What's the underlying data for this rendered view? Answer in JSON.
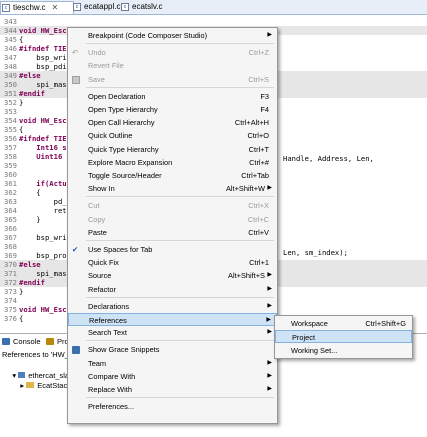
{
  "tabs": [
    {
      "label": "tieschw.c",
      "active": true,
      "closable": true
    },
    {
      "label": "ecatappl.c",
      "active": false,
      "closable": false
    },
    {
      "label": "ecatslv.c",
      "active": false,
      "closable": false
    }
  ],
  "editor": {
    "lines": [
      {
        "num": "343",
        "code": "",
        "highlight": false
      },
      {
        "num": "344",
        "code": "void HW_Esc",
        "highlight": true
      },
      {
        "num": "345",
        "code": "{",
        "highlight": false
      },
      {
        "num": "346",
        "code": "#ifndef TIES",
        "highlight": false
      },
      {
        "num": "347",
        "code": "    bsp_wri",
        "highlight": false
      },
      {
        "num": "348",
        "code": "    bsp_pdi",
        "highlight": false
      },
      {
        "num": "349",
        "code": "#else",
        "highlight": true
      },
      {
        "num": "350",
        "code": "    spi_mast",
        "highlight": true
      },
      {
        "num": "351",
        "code": "#endif",
        "highlight": true
      },
      {
        "num": "352",
        "code": "}",
        "highlight": false
      },
      {
        "num": "353",
        "code": "",
        "highlight": false
      },
      {
        "num": "354",
        "code": "void HW_Esc",
        "highlight": false
      },
      {
        "num": "355",
        "code": "{",
        "highlight": false
      },
      {
        "num": "356",
        "code": "#ifndef TIES",
        "highlight": false
      },
      {
        "num": "357",
        "code": "    Int16 s",
        "highlight": false
      },
      {
        "num": "358",
        "code": "    Uint16 A",
        "highlight": false
      },
      {
        "num": "359",
        "code": "",
        "highlight": false
      },
      {
        "num": "360",
        "code": "",
        "highlight": false
      },
      {
        "num": "361",
        "code": "    if(Actua",
        "highlight": false
      },
      {
        "num": "362",
        "code": "    {",
        "highlight": false
      },
      {
        "num": "363",
        "code": "        pd_",
        "highlight": false
      },
      {
        "num": "364",
        "code": "        ret",
        "highlight": false
      },
      {
        "num": "365",
        "code": "    }",
        "highlight": false
      },
      {
        "num": "366",
        "code": "",
        "highlight": false
      },
      {
        "num": "367",
        "code": "    bsp_wri",
        "highlight": false
      },
      {
        "num": "368",
        "code": "",
        "highlight": false
      },
      {
        "num": "369",
        "code": "    bsp_pro",
        "highlight": false
      },
      {
        "num": "370",
        "code": "#else",
        "highlight": true
      },
      {
        "num": "371",
        "code": "    spi_mast",
        "highlight": true
      },
      {
        "num": "372",
        "code": "#endif",
        "highlight": true
      },
      {
        "num": "373",
        "code": "}",
        "highlight": false
      },
      {
        "num": "374",
        "code": "",
        "highlight": false
      },
      {
        "num": "375",
        "code": "void HW_Esc",
        "highlight": false
      },
      {
        "num": "376",
        "code": "{",
        "highlight": false
      }
    ],
    "right_fragment_1": "Handle, Address, Len,",
    "right_fragment_2": "Len, sm_index);"
  },
  "panel": {
    "console_tab": "Console",
    "other_tab": "Pro",
    "references_label": "References to 'HW_E",
    "tree_item_1": "ethercat_slave",
    "tree_item_2": "EcatStack"
  },
  "context_menu": {
    "items": [
      {
        "label": "Breakpoint (Code Composer Studio)",
        "accel": "",
        "submenu": true,
        "disabled": false,
        "icon": ""
      },
      {
        "sep": true
      },
      {
        "label": "Undo",
        "accel": "Ctrl+Z",
        "submenu": false,
        "disabled": true,
        "icon": "undo-icon"
      },
      {
        "label": "Revert File",
        "accel": "",
        "submenu": false,
        "disabled": true,
        "icon": ""
      },
      {
        "label": "Save",
        "accel": "Ctrl+S",
        "submenu": false,
        "disabled": true,
        "icon": "save-icon"
      },
      {
        "sep": true
      },
      {
        "label": "Open Declaration",
        "accel": "F3",
        "submenu": false,
        "disabled": false,
        "icon": ""
      },
      {
        "label": "Open Type Hierarchy",
        "accel": "F4",
        "submenu": false,
        "disabled": false,
        "icon": ""
      },
      {
        "label": "Open Call Hierarchy",
        "accel": "Ctrl+Alt+H",
        "submenu": false,
        "disabled": false,
        "icon": ""
      },
      {
        "label": "Quick Outline",
        "accel": "Ctrl+O",
        "submenu": false,
        "disabled": false,
        "icon": ""
      },
      {
        "label": "Quick Type Hierarchy",
        "accel": "Ctrl+T",
        "submenu": false,
        "disabled": false,
        "icon": ""
      },
      {
        "label": "Explore Macro Expansion",
        "accel": "Ctrl+#",
        "submenu": false,
        "disabled": false,
        "icon": ""
      },
      {
        "label": "Toggle Source/Header",
        "accel": "Ctrl+Tab",
        "submenu": false,
        "disabled": false,
        "icon": ""
      },
      {
        "label": "Show In",
        "accel": "Alt+Shift+W",
        "submenu": true,
        "disabled": false,
        "icon": ""
      },
      {
        "sep": true
      },
      {
        "label": "Cut",
        "accel": "Ctrl+X",
        "submenu": false,
        "disabled": true,
        "icon": ""
      },
      {
        "label": "Copy",
        "accel": "Ctrl+C",
        "submenu": false,
        "disabled": true,
        "icon": ""
      },
      {
        "label": "Paste",
        "accel": "Ctrl+V",
        "submenu": false,
        "disabled": false,
        "icon": ""
      },
      {
        "sep": true
      },
      {
        "label": "Use Spaces for Tab",
        "accel": "",
        "submenu": false,
        "disabled": false,
        "icon": "checkmark-icon"
      },
      {
        "label": "Quick Fix",
        "accel": "Ctrl+1",
        "submenu": false,
        "disabled": false,
        "icon": ""
      },
      {
        "label": "Source",
        "accel": "Alt+Shift+S",
        "submenu": true,
        "disabled": false,
        "icon": ""
      },
      {
        "label": "Refactor",
        "accel": "",
        "submenu": true,
        "disabled": false,
        "icon": ""
      },
      {
        "sep": true
      },
      {
        "label": "Declarations",
        "accel": "",
        "submenu": true,
        "disabled": false,
        "icon": ""
      },
      {
        "label": "References",
        "accel": "",
        "submenu": true,
        "disabled": false,
        "icon": "",
        "selected": true
      },
      {
        "label": "Search Text",
        "accel": "",
        "submenu": true,
        "disabled": false,
        "icon": ""
      },
      {
        "sep": true
      },
      {
        "label": "Show Grace Snippets",
        "accel": "",
        "submenu": false,
        "disabled": false,
        "icon": "snippets-icon"
      },
      {
        "label": "Team",
        "accel": "",
        "submenu": true,
        "disabled": false,
        "icon": ""
      },
      {
        "label": "Compare With",
        "accel": "",
        "submenu": true,
        "disabled": false,
        "icon": ""
      },
      {
        "label": "Replace With",
        "accel": "",
        "submenu": true,
        "disabled": false,
        "icon": ""
      },
      {
        "sep": true
      },
      {
        "label": "Preferences...",
        "accel": "",
        "submenu": false,
        "disabled": false,
        "icon": ""
      }
    ]
  },
  "references_submenu": {
    "items": [
      {
        "label": "Workspace",
        "accel": "Ctrl+Shift+G",
        "selected": false
      },
      {
        "label": "Project",
        "accel": "",
        "selected": true
      },
      {
        "label": "Working Set...",
        "accel": "",
        "selected": false
      }
    ]
  },
  "colors": {
    "menu_bg": "#f5f5f5",
    "selection": "#cfe3f7",
    "selection_border": "#86b2e0",
    "keyword": "#7f0055",
    "highlight_line": "#e6e6e6"
  }
}
